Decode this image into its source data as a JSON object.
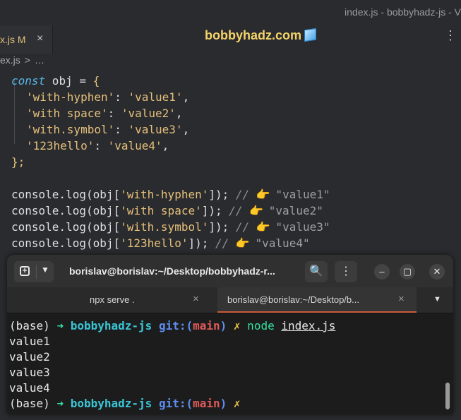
{
  "window": {
    "title": "index.js - bobbyhadz-js - V"
  },
  "editor": {
    "tab": {
      "label": "x.js M",
      "close": "×"
    },
    "watermark": "bobbyhadz.com",
    "more_actions": "⋮",
    "breadcrumb": {
      "file": "ex.js",
      "sep": ">",
      "more": "…"
    },
    "code": {
      "l1": {
        "kw": "const",
        "name": " obj ",
        "eq": "= ",
        "brace": "{"
      },
      "l2": {
        "key": "'with-hyphen'",
        "colon": ": ",
        "val": "'value1'",
        "comma": ","
      },
      "l3": {
        "key": "'with space'",
        "colon": ": ",
        "val": "'value2'",
        "comma": ","
      },
      "l4": {
        "key": "'with.symbol'",
        "colon": ": ",
        "val": "'value3'",
        "comma": ","
      },
      "l5": {
        "key": "'123hello'",
        "colon": ": ",
        "val": "'value4'",
        "comma": ","
      },
      "l6": "};",
      "logs": [
        {
          "pre": "console.log(obj[",
          "key": "'with-hyphen'",
          "post": "]); ",
          "cmt": "//",
          "emoji": "👉",
          "res": " \"value1\""
        },
        {
          "pre": "console.log(obj[",
          "key": "'with space'",
          "post": "]); ",
          "cmt": "//",
          "emoji": "👉",
          "res": " \"value2\""
        },
        {
          "pre": "console.log(obj[",
          "key": "'with.symbol'",
          "post": "]); ",
          "cmt": "//",
          "emoji": "👉",
          "res": " \"value3\""
        },
        {
          "pre": "console.log(obj[",
          "key": "'123hello'",
          "post": "]); ",
          "cmt": "//",
          "emoji": "👉",
          "res": " \"value4\""
        }
      ]
    }
  },
  "terminal": {
    "title": "borislav@borislav:~/Desktop/bobbyhadz-r...",
    "buttons": {
      "search": "🔍",
      "menu": "⋮",
      "minimize": "–",
      "maximize": "▢",
      "close": "✕"
    },
    "tabs": [
      {
        "label": "npx serve .",
        "close": "×"
      },
      {
        "label": "borislav@borislav:~/Desktop/b...",
        "close": "×"
      }
    ],
    "tabs_menu": "▼",
    "prompt": {
      "env": "(base) ",
      "arrow": "➜",
      "dir": " bobbyhadz-js ",
      "git": "git:(",
      "branch": "main",
      "gitclose": ")",
      "x": " ✗"
    },
    "command": {
      "node": " node ",
      "file": "index.js"
    },
    "output": [
      "value1",
      "value2",
      "value3",
      "value4"
    ]
  }
}
